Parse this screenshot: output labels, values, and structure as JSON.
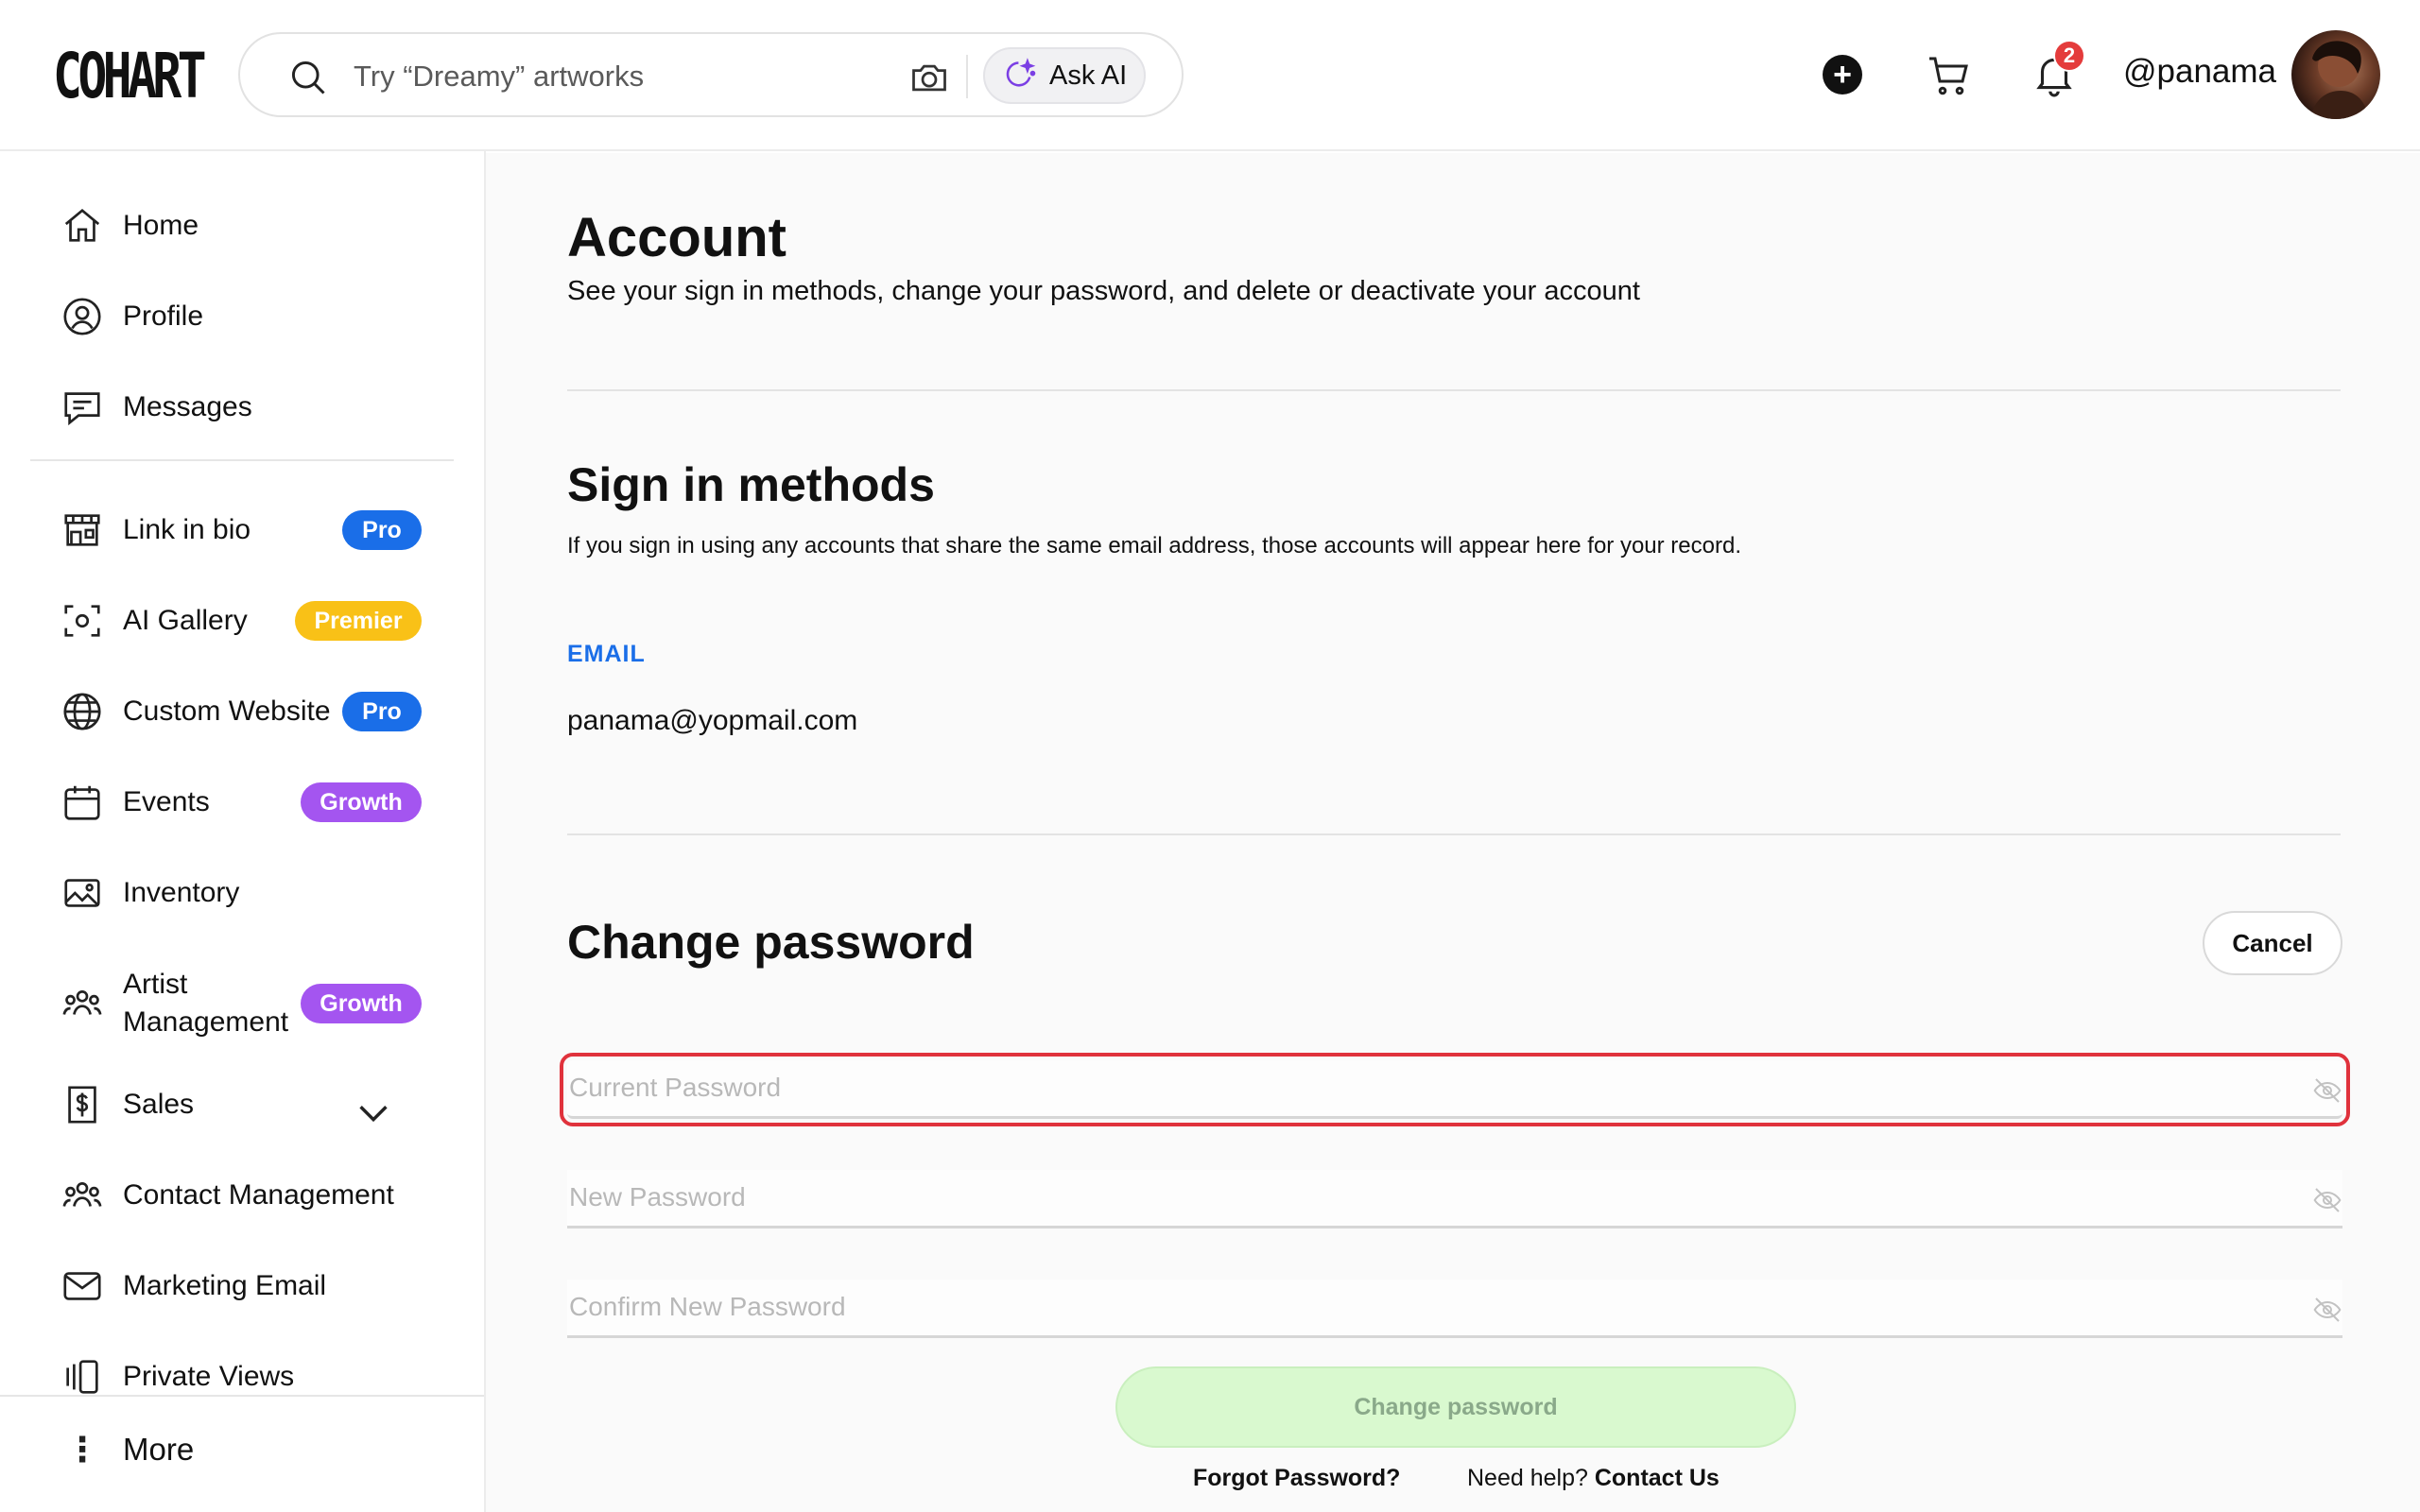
{
  "header": {
    "logo": "COHART",
    "search_placeholder": "Try “Dreamy” artworks",
    "ask_ai_label": "Ask AI",
    "notification_count": "2",
    "username": "@panama",
    "icons": [
      "search-icon",
      "camera-icon",
      "sparkle-icon",
      "plus-icon",
      "cart-icon",
      "bell-icon"
    ]
  },
  "sidebar": {
    "items": [
      {
        "label": "Home",
        "icon": "home-icon"
      },
      {
        "label": "Profile",
        "icon": "profile-icon"
      },
      {
        "label": "Messages",
        "icon": "messages-icon"
      },
      {
        "label": "Link in bio",
        "icon": "storefront-icon",
        "badge": "Pro"
      },
      {
        "label": "AI Gallery",
        "icon": "ai-scan-icon",
        "badge": "Premier"
      },
      {
        "label": "Custom Website",
        "icon": "globe-icon",
        "badge": "Pro"
      },
      {
        "label": "Events",
        "icon": "calendar-icon",
        "badge": "Growth"
      },
      {
        "label": "Inventory",
        "icon": "image-icon"
      },
      {
        "label": "Artist Management",
        "icon": "group-icon",
        "badge": "Growth"
      },
      {
        "label": "Sales",
        "icon": "dollar-icon"
      },
      {
        "label": "Contact Management",
        "icon": "contacts-icon"
      },
      {
        "label": "Marketing Email",
        "icon": "mail-icon"
      },
      {
        "label": "Private Views",
        "icon": "private-views-icon"
      }
    ],
    "more_label": "More"
  },
  "account": {
    "title": "Account",
    "subtitle": "See your sign in methods, change your password, and delete or deactivate your account"
  },
  "sign_in": {
    "title": "Sign in methods",
    "description": "If you sign in using any accounts that share the same email address, those accounts will appear here for your record.",
    "email_label": "EMAIL",
    "email_value": "panama@yopmail.com"
  },
  "change_password": {
    "title": "Change password",
    "cancel_label": "Cancel",
    "current_placeholder": "Current Password",
    "new_placeholder": "New Password",
    "confirm_placeholder": "Confirm New Password",
    "submit_label": "Change password",
    "forgot_label": "Forgot Password?",
    "help_text": "Need help?",
    "contact_label": "Contact Us"
  },
  "colors": {
    "pro": "#1a6ee8",
    "premier": "#f9c117",
    "growth": "#a455f0",
    "focus_outline": "#e0323c",
    "submit_disabled": "#d9f9cf"
  }
}
